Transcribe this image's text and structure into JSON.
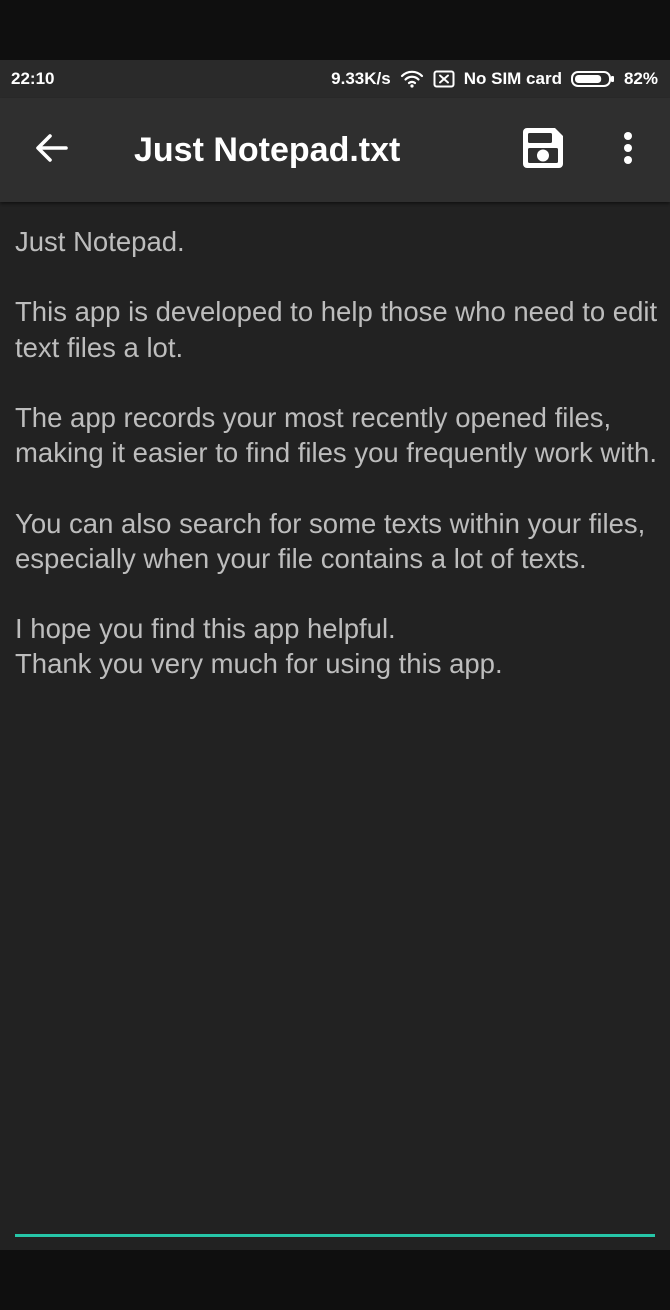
{
  "status_bar": {
    "time": "22:10",
    "network_speed": "9.33K/s",
    "sim_status": "No SIM card",
    "battery_percent": "82%",
    "battery_level": 0.82,
    "icons": [
      "wifi-icon",
      "no-sim-icon",
      "battery-icon"
    ]
  },
  "app_bar": {
    "title": "Just Notepad.txt",
    "icons": [
      "back-arrow-icon",
      "save-icon",
      "more-vert-icon"
    ]
  },
  "editor": {
    "content": "Just Notepad.\n\nThis app is developed to help those who need to edit text files a lot.\n\nThe app records your most recently opened files, making it easier to find files you frequently work with.\n\nYou can also search for some texts within your files, especially when your file contains a lot of texts.\n\nI hope you find this app helpful.\nThank you very much for using this app.",
    "accent_color": "#26c6a8"
  },
  "colors": {
    "app_bar_bg": "#2f2f2f",
    "editor_bg": "#222222",
    "text": "#bdbdbd",
    "accent": "#26c6a8"
  }
}
